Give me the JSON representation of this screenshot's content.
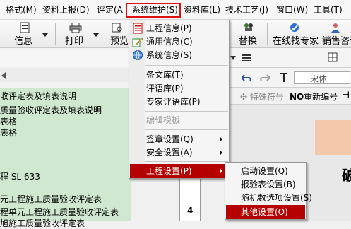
{
  "menubar": {
    "items": [
      "格式(M)",
      "资料上报(D)",
      "评定(A",
      "系统维护(S)",
      "资料库(L)",
      "技术工艺(J)",
      "窗口(W)",
      "工具(T)"
    ]
  },
  "toolbar": {
    "info_label": "信息",
    "print_label": "打印",
    "preview_label": "预览",
    "replace_label": "替换",
    "online_expert_label": "在线找专家",
    "sales_consult_label": "销售咨询"
  },
  "right_toolbar": {
    "font_value": "宋体",
    "special_char_label": "特殊符号",
    "renumber_label": "重新编号",
    "renumber_prefix": "NO"
  },
  "left_tree": {
    "header_text": "收评定表及填表说明",
    "lines": [
      "质量验收评定表及填表说明",
      "表格",
      "表格",
      "",
      "",
      "程 SL 633",
      "",
      "元工程施工质量验收评定表",
      "程单元工程施工质量验收评定表",
      "旭施工质量验收评定表"
    ]
  },
  "doc": {
    "big_char": "破",
    "number": "4"
  },
  "system_menu": {
    "items": [
      {
        "label": "工程信息(P)",
        "icon": "document-icon"
      },
      {
        "label": "通用信息(C)",
        "icon": "edit-pencil-icon"
      },
      {
        "label": "系统信息(S)",
        "icon": "globe-icon"
      },
      {
        "label": "条文库(T)"
      },
      {
        "label": "评语库(P)"
      },
      {
        "label": "专家评语库(P)"
      },
      {
        "label": "编辑模板"
      },
      {
        "label": "签章设置(Q)"
      },
      {
        "label": "安全设置(A)"
      },
      {
        "label": "工程设置(P)"
      }
    ]
  },
  "project_submenu": {
    "items": [
      "启动设置(Q)",
      "报验表设置(B)",
      "随机数选项设置(S)",
      "其他设置(O)"
    ]
  },
  "colors": {
    "menu_highlight": "#b50000",
    "tree_background": "#cfe8cf",
    "callout_border": "#e01010"
  }
}
